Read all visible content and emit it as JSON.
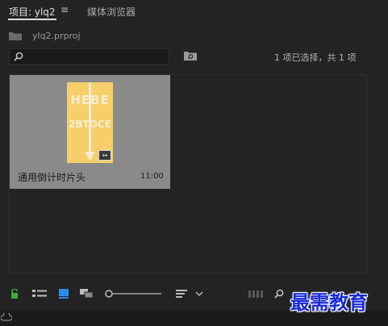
{
  "tabs": {
    "project_label": "项目: ylq2",
    "menu_icon": "hamburger-icon",
    "media_browser_label": "媒体浏览器"
  },
  "path": {
    "icon": "bin-folder-icon",
    "file": "ylq2.prproj"
  },
  "search": {
    "placeholder": "",
    "icon": "search-icon"
  },
  "new_bin_icon": "new-bin-icon",
  "selection_info": "1 项已选择，共 1 项",
  "clip": {
    "name": "通用倒计时片头",
    "duration": "11:00",
    "thumb_lines": [
      "HEBE",
      "2BTOCE"
    ],
    "thumb_color": "#f6cf6b",
    "badge_icon": "sequence-icon"
  },
  "toolbar": {
    "icons": [
      "lock-icon",
      "list-view-icon",
      "icon-view-icon",
      "freeform-view-icon",
      "zoom-slider",
      "sort-icon",
      "chevron-down-icon",
      "automate-icon",
      "search-icon",
      "new-bin-icon",
      "new-item-icon",
      "trash-icon"
    ]
  },
  "watermark": "最需教育",
  "colors": {
    "panel_bg": "#232323",
    "accent_blue": "#2d8ceb",
    "lock_green": "#3fae3f"
  }
}
